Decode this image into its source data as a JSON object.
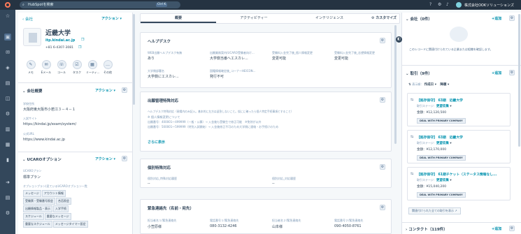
{
  "topbar": {
    "search_placeholder": "HubSpotを検索",
    "shortcut": "Ctrl K",
    "account_name": "株式会社OOKソリューションズ"
  },
  "left": {
    "back_label": "会社",
    "actions_label": "アクション",
    "company_name": "近畿大学",
    "domain": "itp.kindai.ac.jp",
    "phone": "+81 6-4307-3081",
    "activity_buttons": [
      "メモ",
      "Eメール",
      "コール",
      "タスク",
      "ミーティ...",
      "その他"
    ],
    "overview": {
      "title": "会社概要",
      "actions": "アクション",
      "fields": [
        {
          "label": "学校住所",
          "value": "大阪府東大阪市小若江３－４－１"
        },
        {
          "label": "入試サイト",
          "value": "https://kindai.jp/exam/system/"
        },
        {
          "label": "公式URL",
          "value": "https://www.kindai.ac.jp"
        }
      ]
    },
    "ucaro": {
      "title": "UCAROオプション",
      "actions": "アクション",
      "plan_label": "UCAROプラン",
      "plan_value": "標準プラン",
      "options_label": "オプションプラン(見ているUCAROオプション一覧",
      "tags": [
        "メッセージ",
        "アカウント情報",
        "受験票・受験番号照会",
        "合否照会",
        "出願情報製品・表示",
        "入学手続",
        "スケジュール",
        "重要なメッセージ",
        "重要なスケジュール",
        "メッセージタイマー設定"
      ]
    }
  },
  "middle": {
    "tabs": [
      "概要",
      "アクティビティー",
      "インテリジェンス"
    ],
    "customize": "カスタマイズ",
    "helpdesk": {
      "title": "ヘルプデスク",
      "row1": [
        {
          "label": "WEB出願ヘルプデスク有無",
          "value": "あり"
        },
        {
          "label": "出願業務案内(UCARO受験者向け...",
          "value": "大学側当番へエスカレ..."
        },
        {
          "label": "受験料入金完了後_個人情報変更",
          "value": "変更可能"
        },
        {
          "label": "受験料入金完了後_志望情報変更",
          "value": "変更可能"
        }
      ],
      "row2": [
        {
          "label": "大学側部署名",
          "value": "大学側にエスカレ..."
        },
        {
          "label": "国籍情報確定後_コーナーHEICON...",
          "value": "発行不可"
        }
      ]
    },
    "excharge": {
      "title": "出願管理特殊対応",
      "note1": "ヘルプデスク特殊対応（現場内のみ記入。基本的に左方は返答しないこと。仮にに確ったら個人特定手続事項とすること）",
      "note2": "※ 個人情報変更について",
      "note3": "出願番号：400001〜499999（一般・公募）→ 入金後も受験生で修正可能　※免除が以外",
      "note4": "出願番号：500001〜599999（特別入試開始）→ 入金後修正不可のため大学側に連絡・お手続けのため",
      "more": "さらに表示"
    },
    "special": {
      "title": "個別特殊対応",
      "lbl1": "個別対応_特殊対応履歴",
      "val1": "--",
      "lbl2": "個別対応_対応履歴",
      "val2": "--"
    },
    "contact": {
      "title": "緊急連絡先（名前・宛先）",
      "fields": [
        {
          "label": "担当者名１/緊急連絡先",
          "value": "小笠原様"
        },
        {
          "label": "電話番号１/緊急連絡先",
          "value": "080-3132-4246"
        },
        {
          "label": "担当者名２/緊急連絡先",
          "value": "山本様"
        },
        {
          "label": "電話番号２/緊急連絡先",
          "value": "090-4050-8761"
        }
      ]
    }
  },
  "right": {
    "companies": {
      "title": "会社（0件）",
      "add": "+追加",
      "empty": "このレコードに関連付けられている企業または組織を確認します。"
    },
    "deals": {
      "title": "取引（9件）",
      "add": "+追加",
      "display_label": "表示順：",
      "sort1": "作成日",
      "sort2": "降順",
      "items": [
        {
          "name": "【既存保守】 63期　近畿大学",
          "stage_label": "取引ステージ：",
          "stage": "更望収集",
          "amount": "金額：¥12,120,500",
          "badge": "DEAL WITH PRIMARY COMPANY"
        },
        {
          "name": "【既存保守】 63期　近畿大学",
          "stage_label": "取引ステージ：",
          "stage": "更望収集",
          "amount": "金額：¥12,170,000",
          "badge": "DEAL WITH PRIMARY COMPANY"
        },
        {
          "name": "【既存保守】 61期チケット（ステータス情報なし...",
          "stage_label": "取引ステージ：",
          "stage": "更望収集",
          "amount": "金額：¥15,040,200",
          "badge": "DEAL WITH PRIMARY COMPANY"
        }
      ],
      "view_all": "関連付けられた全ての取引を表示"
    },
    "contacts": {
      "title": "コンタクト（119件）",
      "add": "+追加"
    }
  },
  "colors": {
    "topbar": "#253342",
    "nav": "#33475b",
    "link": "#0091ae"
  }
}
